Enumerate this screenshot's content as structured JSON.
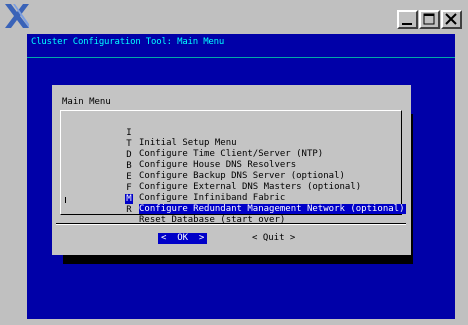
{
  "window": {
    "buttons": {
      "minimize": "minimize",
      "maximize": "maximize",
      "close": "close"
    }
  },
  "terminal": {
    "title": "Cluster Configuration Tool: Main Menu"
  },
  "dialog": {
    "title": "Main Menu",
    "items": [
      {
        "key": "I",
        "label": "Initial Setup Menu",
        "selected": false
      },
      {
        "key": "T",
        "label": "Configure Time Client/Server (NTP)",
        "selected": false
      },
      {
        "key": "D",
        "label": "Configure House DNS Resolvers",
        "selected": false
      },
      {
        "key": "B",
        "label": "Configure Backup DNS Server (optional)",
        "selected": false
      },
      {
        "key": "E",
        "label": "Configure External DNS Masters (optional)",
        "selected": false
      },
      {
        "key": "F",
        "label": "Configure Infiniband Fabric",
        "selected": false
      },
      {
        "key": "M",
        "label": "Configure Redundant Management Network (optional)",
        "selected": true
      },
      {
        "key": "R",
        "label": "Reset Database (start over)",
        "selected": false
      }
    ],
    "ok_label": "<  OK  >",
    "quit_label": "< Quit >"
  },
  "colors": {
    "terminal_bg": "#0000a8",
    "title_text": "#00ffff",
    "dialog_bg": "#c4c4c4",
    "highlight": "#0000c8"
  }
}
